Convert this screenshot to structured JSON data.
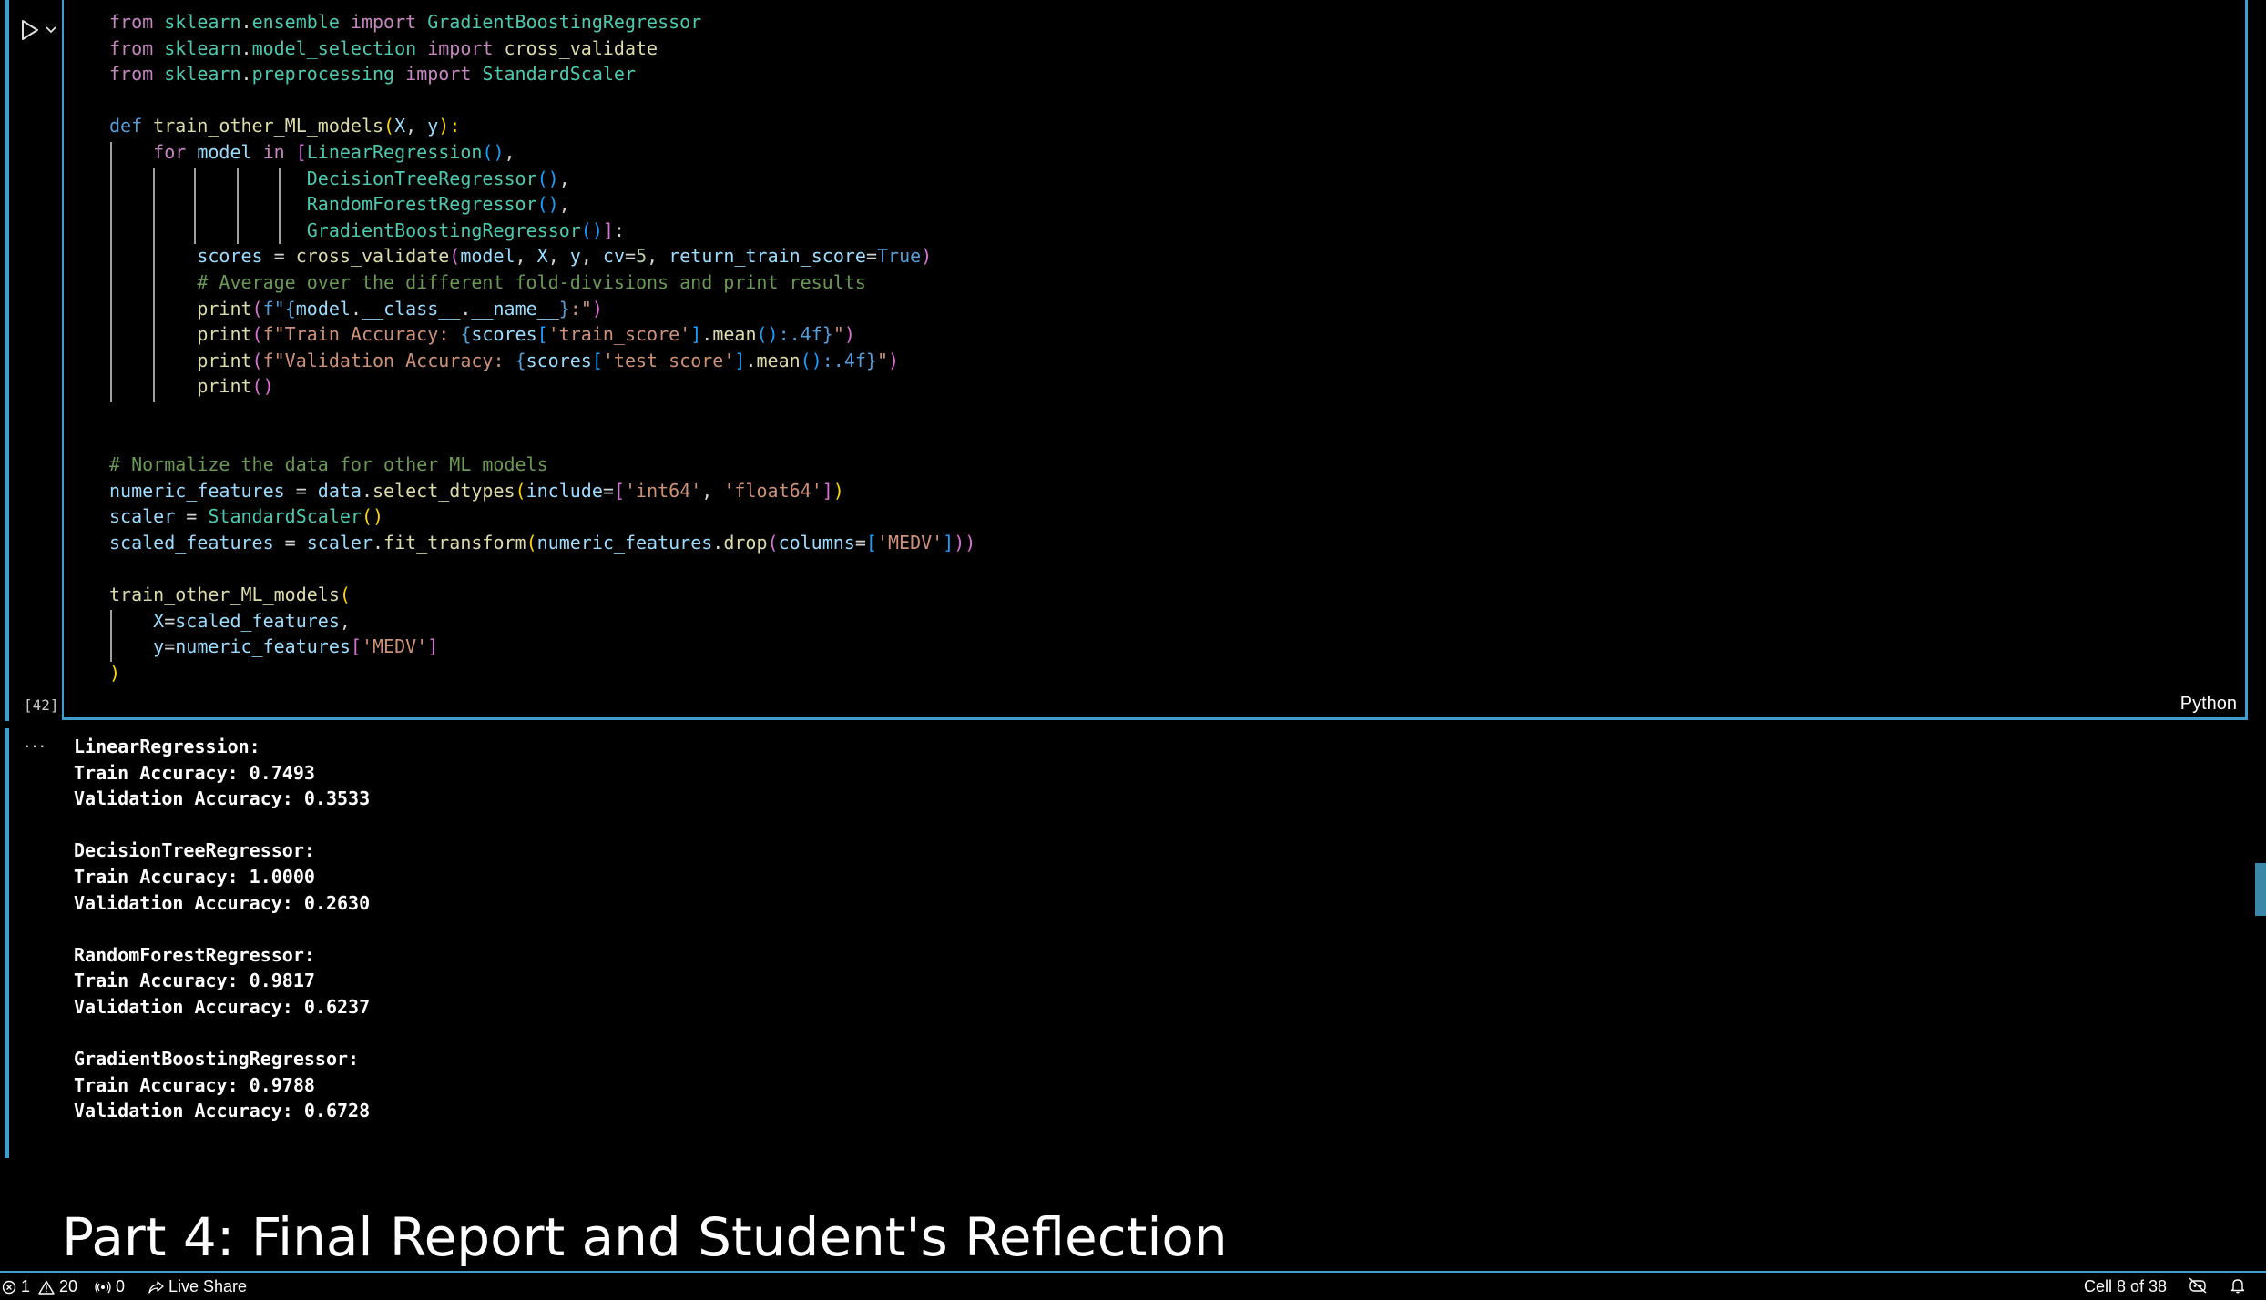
{
  "cell": {
    "execution_count": "[42]",
    "language": "Python",
    "code_lines": [
      [
        {
          "t": "from ",
          "c": "kw2"
        },
        {
          "t": "sklearn",
          "c": "mod"
        },
        {
          "t": ".",
          "c": "pln"
        },
        {
          "t": "ensemble",
          "c": "mod"
        },
        {
          "t": " import ",
          "c": "kw2"
        },
        {
          "t": "GradientBoostingRegressor",
          "c": "mod"
        }
      ],
      [
        {
          "t": "from ",
          "c": "kw2"
        },
        {
          "t": "sklearn",
          "c": "mod"
        },
        {
          "t": ".",
          "c": "pln"
        },
        {
          "t": "model_selection",
          "c": "mod"
        },
        {
          "t": " import ",
          "c": "kw2"
        },
        {
          "t": "cross_validate",
          "c": "fn"
        }
      ],
      [
        {
          "t": "from ",
          "c": "kw2"
        },
        {
          "t": "sklearn",
          "c": "mod"
        },
        {
          "t": ".",
          "c": "pln"
        },
        {
          "t": "preprocessing",
          "c": "mod"
        },
        {
          "t": " import ",
          "c": "kw2"
        },
        {
          "t": "StandardScaler",
          "c": "mod"
        }
      ],
      [],
      [
        {
          "t": "def ",
          "c": "kw"
        },
        {
          "t": "train_other_ML_models",
          "c": "fn"
        },
        {
          "t": "(",
          "c": "br1"
        },
        {
          "t": "X",
          "c": "var"
        },
        {
          "t": ", ",
          "c": "pln"
        },
        {
          "t": "y",
          "c": "var"
        },
        {
          "t": "):",
          "c": "br1"
        }
      ],
      [
        {
          "t": "    for ",
          "c": "kw2"
        },
        {
          "t": "model",
          "c": "var"
        },
        {
          "t": " in ",
          "c": "kw2"
        },
        {
          "t": "[",
          "c": "br2"
        },
        {
          "t": "LinearRegression",
          "c": "mod"
        },
        {
          "t": "()",
          "c": "br3"
        },
        {
          "t": ",",
          "c": "pln"
        }
      ],
      [
        {
          "t": "                  ",
          "c": "pln"
        },
        {
          "t": "DecisionTreeRegressor",
          "c": "mod"
        },
        {
          "t": "()",
          "c": "br3"
        },
        {
          "t": ",",
          "c": "pln"
        }
      ],
      [
        {
          "t": "                  ",
          "c": "pln"
        },
        {
          "t": "RandomForestRegressor",
          "c": "mod"
        },
        {
          "t": "()",
          "c": "br3"
        },
        {
          "t": ",",
          "c": "pln"
        }
      ],
      [
        {
          "t": "                  ",
          "c": "pln"
        },
        {
          "t": "GradientBoostingRegressor",
          "c": "mod"
        },
        {
          "t": "()",
          "c": "br3"
        },
        {
          "t": "]",
          "c": "br2"
        },
        {
          "t": ":",
          "c": "pln"
        }
      ],
      [
        {
          "t": "        scores",
          "c": "var"
        },
        {
          "t": " = ",
          "c": "pln"
        },
        {
          "t": "cross_validate",
          "c": "fn"
        },
        {
          "t": "(",
          "c": "br2"
        },
        {
          "t": "model",
          "c": "var"
        },
        {
          "t": ", ",
          "c": "pln"
        },
        {
          "t": "X",
          "c": "var"
        },
        {
          "t": ", ",
          "c": "pln"
        },
        {
          "t": "y",
          "c": "var"
        },
        {
          "t": ", ",
          "c": "pln"
        },
        {
          "t": "cv",
          "c": "var"
        },
        {
          "t": "=",
          "c": "pln"
        },
        {
          "t": "5",
          "c": "num"
        },
        {
          "t": ", ",
          "c": "pln"
        },
        {
          "t": "return_train_score",
          "c": "var"
        },
        {
          "t": "=",
          "c": "pln"
        },
        {
          "t": "True",
          "c": "kw"
        },
        {
          "t": ")",
          "c": "br2"
        }
      ],
      [
        {
          "t": "        # Average over the different fold-divisions and print results",
          "c": "com"
        }
      ],
      [
        {
          "t": "        print",
          "c": "fn"
        },
        {
          "t": "(",
          "c": "br2"
        },
        {
          "t": "f\"",
          "c": "kw"
        },
        {
          "t": "{",
          "c": "kw"
        },
        {
          "t": "model",
          "c": "var"
        },
        {
          "t": ".",
          "c": "pln"
        },
        {
          "t": "__class__",
          "c": "var"
        },
        {
          "t": ".",
          "c": "pln"
        },
        {
          "t": "__name__",
          "c": "var"
        },
        {
          "t": "}",
          "c": "kw"
        },
        {
          "t": ":\"",
          "c": "str"
        },
        {
          "t": ")",
          "c": "br2"
        }
      ],
      [
        {
          "t": "        print",
          "c": "fn"
        },
        {
          "t": "(",
          "c": "br2"
        },
        {
          "t": "f\"Train Accuracy: ",
          "c": "str"
        },
        {
          "t": "{",
          "c": "kw"
        },
        {
          "t": "scores",
          "c": "var"
        },
        {
          "t": "[",
          "c": "br3"
        },
        {
          "t": "'train_score'",
          "c": "str"
        },
        {
          "t": "]",
          "c": "br3"
        },
        {
          "t": ".",
          "c": "pln"
        },
        {
          "t": "mean",
          "c": "fn"
        },
        {
          "t": "()",
          "c": "br3"
        },
        {
          "t": ":.4f",
          "c": "kw"
        },
        {
          "t": "}",
          "c": "kw"
        },
        {
          "t": "\"",
          "c": "str"
        },
        {
          "t": ")",
          "c": "br2"
        }
      ],
      [
        {
          "t": "        print",
          "c": "fn"
        },
        {
          "t": "(",
          "c": "br2"
        },
        {
          "t": "f\"Validation Accuracy: ",
          "c": "str"
        },
        {
          "t": "{",
          "c": "kw"
        },
        {
          "t": "scores",
          "c": "var"
        },
        {
          "t": "[",
          "c": "br3"
        },
        {
          "t": "'test_score'",
          "c": "str"
        },
        {
          "t": "]",
          "c": "br3"
        },
        {
          "t": ".",
          "c": "pln"
        },
        {
          "t": "mean",
          "c": "fn"
        },
        {
          "t": "()",
          "c": "br3"
        },
        {
          "t": ":.4f",
          "c": "kw"
        },
        {
          "t": "}",
          "c": "kw"
        },
        {
          "t": "\"",
          "c": "str"
        },
        {
          "t": ")",
          "c": "br2"
        }
      ],
      [
        {
          "t": "        print",
          "c": "fn"
        },
        {
          "t": "()",
          "c": "br2"
        }
      ],
      [],
      [],
      [
        {
          "t": "# Normalize the data for other ML models",
          "c": "com"
        }
      ],
      [
        {
          "t": "numeric_features",
          "c": "var"
        },
        {
          "t": " = ",
          "c": "pln"
        },
        {
          "t": "data",
          "c": "var"
        },
        {
          "t": ".",
          "c": "pln"
        },
        {
          "t": "select_dtypes",
          "c": "fn"
        },
        {
          "t": "(",
          "c": "br1"
        },
        {
          "t": "include",
          "c": "var"
        },
        {
          "t": "=",
          "c": "pln"
        },
        {
          "t": "[",
          "c": "br2"
        },
        {
          "t": "'int64'",
          "c": "str"
        },
        {
          "t": ", ",
          "c": "pln"
        },
        {
          "t": "'float64'",
          "c": "str"
        },
        {
          "t": "]",
          "c": "br2"
        },
        {
          "t": ")",
          "c": "br1"
        }
      ],
      [
        {
          "t": "scaler",
          "c": "var"
        },
        {
          "t": " = ",
          "c": "pln"
        },
        {
          "t": "StandardScaler",
          "c": "mod"
        },
        {
          "t": "()",
          "c": "br1"
        }
      ],
      [
        {
          "t": "scaled_features",
          "c": "var"
        },
        {
          "t": " = ",
          "c": "pln"
        },
        {
          "t": "scaler",
          "c": "var"
        },
        {
          "t": ".",
          "c": "pln"
        },
        {
          "t": "fit_transform",
          "c": "fn"
        },
        {
          "t": "(",
          "c": "br1"
        },
        {
          "t": "numeric_features",
          "c": "var"
        },
        {
          "t": ".",
          "c": "pln"
        },
        {
          "t": "drop",
          "c": "fn"
        },
        {
          "t": "(",
          "c": "br2"
        },
        {
          "t": "columns",
          "c": "var"
        },
        {
          "t": "=",
          "c": "pln"
        },
        {
          "t": "[",
          "c": "br3"
        },
        {
          "t": "'MEDV'",
          "c": "str"
        },
        {
          "t": "]",
          "c": "br3"
        },
        {
          "t": "))",
          "c": "br2"
        }
      ],
      [],
      [
        {
          "t": "train_other_ML_models",
          "c": "fn"
        },
        {
          "t": "(",
          "c": "br1"
        }
      ],
      [
        {
          "t": "    X",
          "c": "var"
        },
        {
          "t": "=",
          "c": "pln"
        },
        {
          "t": "scaled_features",
          "c": "var"
        },
        {
          "t": ",",
          "c": "pln"
        }
      ],
      [
        {
          "t": "    y",
          "c": "var"
        },
        {
          "t": "=",
          "c": "pln"
        },
        {
          "t": "numeric_features",
          "c": "var"
        },
        {
          "t": "[",
          "c": "br2"
        },
        {
          "t": "'MEDV'",
          "c": "str"
        },
        {
          "t": "]",
          "c": "br2"
        }
      ],
      [
        {
          "t": ")",
          "c": "br1"
        }
      ]
    ]
  },
  "output": {
    "more_label": "···",
    "lines": [
      "LinearRegression:",
      "Train Accuracy: 0.7493",
      "Validation Accuracy: 0.3533",
      "",
      "DecisionTreeRegressor:",
      "Train Accuracy: 1.0000",
      "Validation Accuracy: 0.2630",
      "",
      "RandomForestRegressor:",
      "Train Accuracy: 0.9817",
      "Validation Accuracy: 0.6237",
      "",
      "GradientBoostingRegressor:",
      "Train Accuracy: 0.9788",
      "Validation Accuracy: 0.6728"
    ]
  },
  "markdown": {
    "heading": "Part 4: Final Report and Student's Reflection"
  },
  "status_bar": {
    "errors": "1",
    "warnings": "20",
    "ports": "0",
    "live_share": "Live Share",
    "cell_position": "Cell 8 of 38"
  },
  "colors": {
    "accent": "#3e9ecd",
    "background": "#000000"
  },
  "icons": [
    "run-cell-icon",
    "chevron-down-icon",
    "error-icon",
    "warning-icon",
    "ports-icon",
    "live-share-icon",
    "copilot-disabled-icon",
    "bell-icon"
  ]
}
